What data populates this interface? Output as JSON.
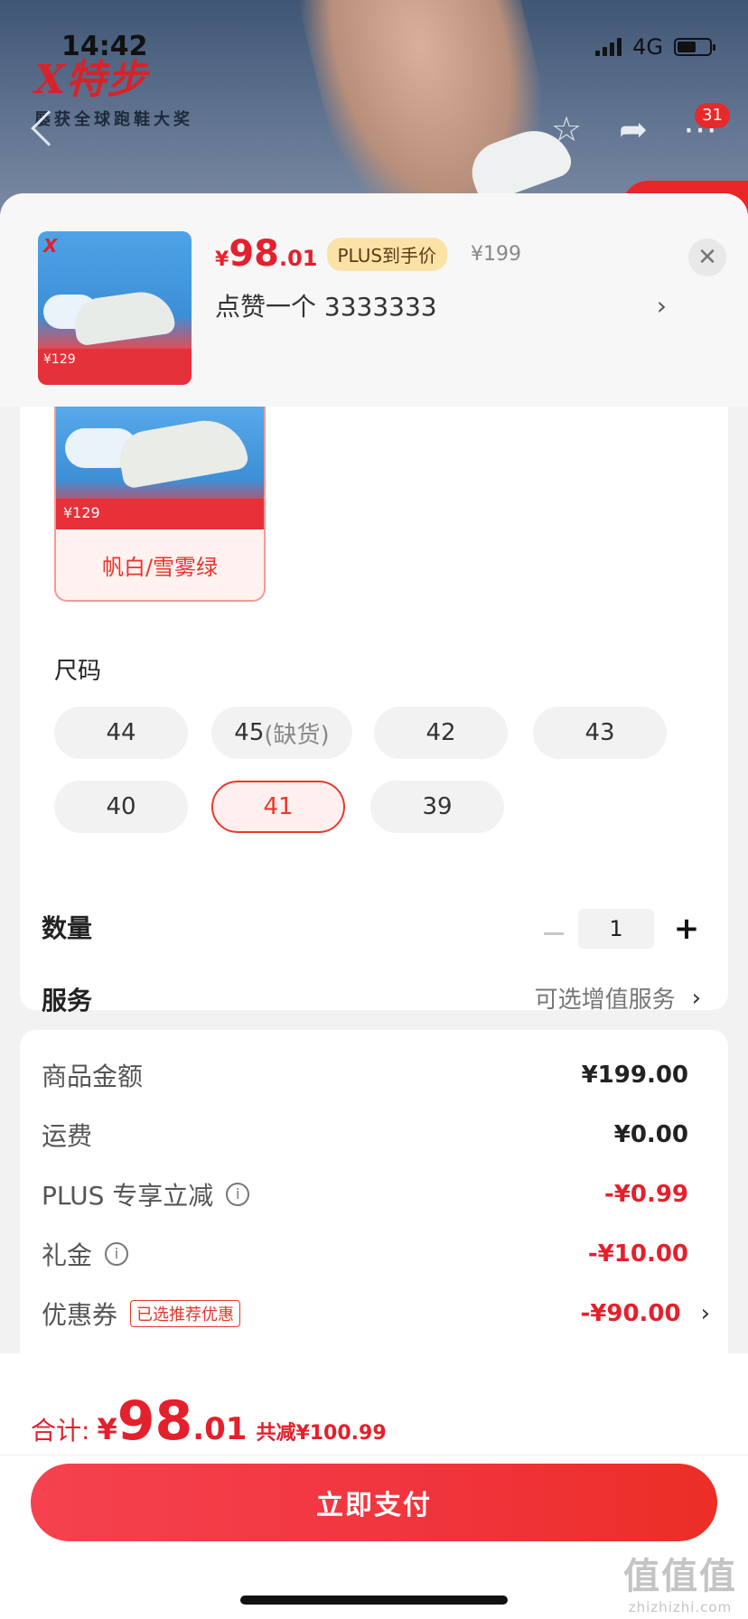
{
  "status_bar": {
    "time": "14:42",
    "network": "4G"
  },
  "brand": {
    "logo_text": "X特步",
    "slogan": "屡获全球跑鞋大奖"
  },
  "nav": {
    "cart_badge": "31"
  },
  "product": {
    "price_currency": "¥",
    "price_int": "98",
    "price_dec": ".01",
    "plus_badge": "PLUS到手价",
    "original_price": "¥199",
    "spec_summary": "点赞一个  3333333",
    "thumb_price": "¥129"
  },
  "color_option": {
    "label": "帆白/雪雾绿",
    "banner_price": "¥129"
  },
  "sizes": {
    "title": "尺码",
    "items": [
      {
        "label": "44",
        "note": ""
      },
      {
        "label": "45",
        "note": "(缺货)"
      },
      {
        "label": "42",
        "note": ""
      },
      {
        "label": "43",
        "note": ""
      },
      {
        "label": "40",
        "note": ""
      },
      {
        "label": "41",
        "note": ""
      },
      {
        "label": "39",
        "note": ""
      }
    ],
    "selected": "41"
  },
  "quantity": {
    "label": "数量",
    "value": "1"
  },
  "service": {
    "label": "服务",
    "hint": "可选增值服务"
  },
  "price_breakdown": [
    {
      "label": "商品金额",
      "value": "¥199.00",
      "highlight": false
    },
    {
      "label": "运费",
      "value": "¥0.00",
      "highlight": false
    },
    {
      "label": "PLUS 专享立减",
      "value": "-¥0.99",
      "highlight": true
    },
    {
      "label": "礼金",
      "value": "-¥10.00",
      "highlight": true
    },
    {
      "label": "优惠券",
      "value": "-¥90.00",
      "highlight": true,
      "tag": "已选推荐优惠"
    }
  ],
  "footer": {
    "total_label": "合计:",
    "total_currency": "¥",
    "total_int": "98",
    "total_dec": ".01",
    "total_saved": "共减¥100.99",
    "pay_button": "立即支付"
  },
  "watermark": {
    "logo": "值值值",
    "url": "zhizhizhi.com"
  },
  "colors": {
    "accent_red": "#e4202c",
    "plus_gold": "#fbe3a7",
    "selected_border": "#e83a2e"
  }
}
